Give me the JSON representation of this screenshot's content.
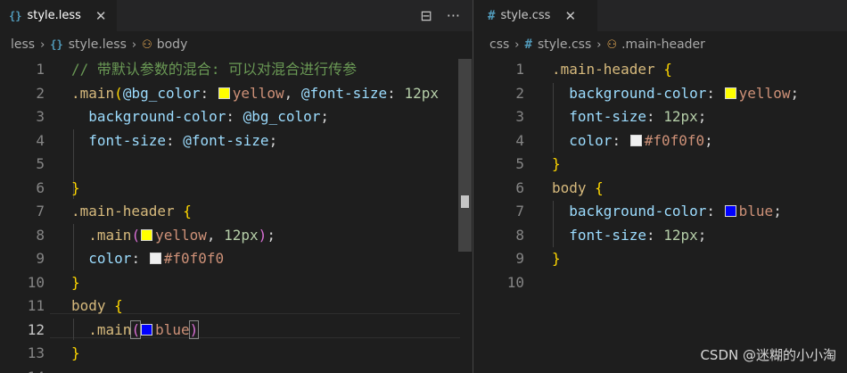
{
  "left": {
    "tab": {
      "icon": "{}",
      "filename": "style.less",
      "close": "✕"
    },
    "actions": {
      "split_icon": "⊟",
      "more_icon": "···"
    },
    "breadcrumb": [
      "less",
      "style.less",
      "body"
    ],
    "lines": [
      {
        "n": "1",
        "html": "<span class=\"c-cm\">// 带默认参数的混合: 可以对混合进行传参</span>"
      },
      {
        "n": "2",
        "html": "<span class=\"c-sel\">.main</span><span class=\"c-br1\">(</span><span class=\"c-var\">@bg_color</span><span class=\"c-p\">: </span><span class=\"sw\" style=\"background:#ffff00\"></span><span class=\"c-val\">yellow</span><span class=\"c-p\">, </span><span class=\"c-var\">@font-size</span><span class=\"c-p\">: </span><span class=\"c-num\">12px</span>"
      },
      {
        "n": "3",
        "html": "  <span class=\"c-var\">background-color</span><span class=\"c-p\">: </span><span class=\"c-var\">@bg_color</span><span class=\"c-p\">;</span>"
      },
      {
        "n": "4",
        "html": "  <span class=\"c-var\">font-size</span><span class=\"c-p\">: </span><span class=\"c-var\">@font-size</span><span class=\"c-p\">;</span>"
      },
      {
        "n": "5",
        "html": ""
      },
      {
        "n": "6",
        "html": "<span class=\"c-br1\">}</span>"
      },
      {
        "n": "7",
        "html": "<span class=\"c-sel\">.main-header</span> <span class=\"c-br1\">{</span>"
      },
      {
        "n": "8",
        "html": "  <span class=\"c-sel\">.main</span><span class=\"c-br2\">(</span><span class=\"sw\" style=\"background:#ffff00\"></span><span class=\"c-val\">yellow</span><span class=\"c-p\">, </span><span class=\"c-num\">12px</span><span class=\"c-br2\">)</span><span class=\"c-p\">;</span>"
      },
      {
        "n": "9",
        "html": "  <span class=\"c-var\">color</span><span class=\"c-p\">: </span><span class=\"sw\" style=\"background:#f0f0f0\"></span><span class=\"c-val\">#f0f0f0</span>"
      },
      {
        "n": "10",
        "html": "<span class=\"c-br1\">}</span>"
      },
      {
        "n": "11",
        "html": "<span class=\"c-sel\">body</span> <span class=\"c-br1\">{</span>"
      },
      {
        "n": "12",
        "html": "  <span class=\"c-sel\">.main</span><span class=\"c-br2\" style=\"outline:1px solid #888\">(</span><span class=\"sw\" style=\"background:#0000ff\"></span><span class=\"c-val\">blue</span><span class=\"c-br2\" style=\"outline:1px solid #888\">)</span>"
      },
      {
        "n": "13",
        "html": "<span class=\"c-br1\">}</span>"
      },
      {
        "n": "14",
        "html": ""
      }
    ],
    "current_line": "12"
  },
  "right": {
    "tab": {
      "icon": "#",
      "filename": "style.css",
      "close": "✕"
    },
    "breadcrumb": [
      "css",
      "style.css",
      ".main-header"
    ],
    "lines": [
      {
        "n": "1",
        "html": "<span class=\"c-sel\">.main-header</span> <span class=\"c-br1\">{</span>"
      },
      {
        "n": "2",
        "html": "  <span class=\"c-var\">background-color</span><span class=\"c-p\">: </span><span class=\"sw\" style=\"background:#ffff00\"></span><span class=\"c-val\">yellow</span><span class=\"c-p\">;</span>"
      },
      {
        "n": "3",
        "html": "  <span class=\"c-var\">font-size</span><span class=\"c-p\">: </span><span class=\"c-num\">12px</span><span class=\"c-p\">;</span>"
      },
      {
        "n": "4",
        "html": "  <span class=\"c-var\">color</span><span class=\"c-p\">: </span><span class=\"sw\" style=\"background:#f0f0f0\"></span><span class=\"c-val\">#f0f0f0</span><span class=\"c-p\">;</span>"
      },
      {
        "n": "5",
        "html": "<span class=\"c-br1\">}</span>"
      },
      {
        "n": "6",
        "html": "<span class=\"c-sel\">body</span> <span class=\"c-br1\">{</span>"
      },
      {
        "n": "7",
        "html": "  <span class=\"c-var\">background-color</span><span class=\"c-p\">: </span><span class=\"sw\" style=\"background:#0000ff\"></span><span class=\"c-val\">blue</span><span class=\"c-p\">;</span>"
      },
      {
        "n": "8",
        "html": "  <span class=\"c-var\">font-size</span><span class=\"c-p\">: </span><span class=\"c-num\">12px</span><span class=\"c-p\">;</span>"
      },
      {
        "n": "9",
        "html": "<span class=\"c-br1\">}</span>"
      },
      {
        "n": "10",
        "html": ""
      }
    ]
  },
  "watermark": "CSDN @迷糊的小小淘",
  "colors": {
    "background": "#1e1e1e",
    "selector": "#d7ba7d",
    "property": "#9cdcfe",
    "comment": "#6a9955"
  }
}
